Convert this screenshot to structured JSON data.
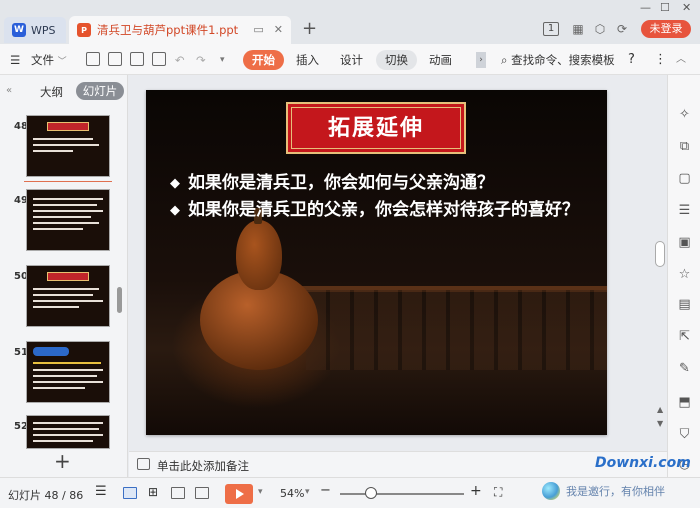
{
  "window": {
    "app_tab": "WPS",
    "doc_tab": "清兵卫与葫芦ppt课件1.ppt",
    "new_tab_symbol": "+",
    "tab_badge": "1",
    "login_label": "未登录"
  },
  "toolbar": {
    "file_label": "文件",
    "tabs": [
      "开始",
      "插入",
      "设计",
      "切换",
      "动画"
    ],
    "active_tab": "开始",
    "search_label": "查找命令、搜索模板",
    "help_symbol": "?",
    "more_symbol": "⋮"
  },
  "left_panel": {
    "tab_outline": "大纲",
    "tab_slides": "幻灯片",
    "thumbnails": [
      {
        "num": "48",
        "variant": "title"
      },
      {
        "num": "49",
        "variant": "text"
      },
      {
        "num": "50",
        "variant": "title"
      },
      {
        "num": "51",
        "variant": "blue"
      },
      {
        "num": "52",
        "variant": "text"
      }
    ],
    "add_symbol": "+"
  },
  "slide": {
    "title": "拓展延伸",
    "bullets": [
      "如果你是清兵卫，你会如何与父亲沟通？",
      "如果你是清兵卫的父亲，你会怎样对待孩子的喜好？"
    ]
  },
  "notes": {
    "placeholder": "单击此处添加备注"
  },
  "statusbar": {
    "slide_counter": "幻灯片 48 / 86",
    "zoom_label": "54%",
    "zoom_level": 0.54,
    "watermark_text": "我是邀行，有你相伴",
    "watermark_logo": "Downxi.com"
  },
  "colors": {
    "accent": "#ee6e47",
    "title_red": "#c4171c",
    "title_gold": "#e6c07a",
    "login_red": "#e7543d"
  }
}
